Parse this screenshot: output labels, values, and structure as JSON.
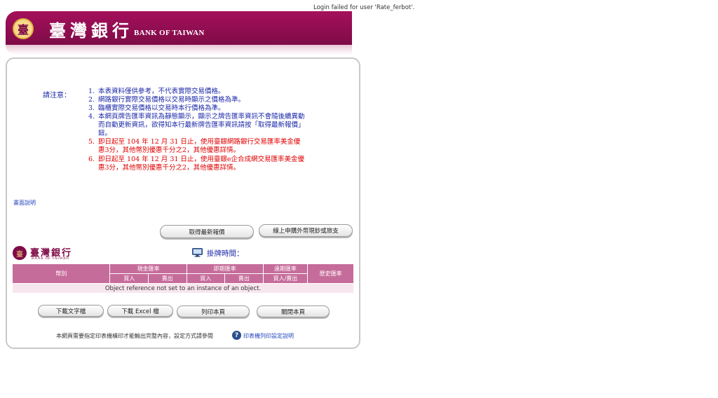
{
  "status": {
    "login_message": "Login failed for user 'Rate_ferbot'."
  },
  "header": {
    "brand_zh": "臺灣銀行",
    "brand_en": "BANK OF TAIWAN",
    "logo_glyph": "臺"
  },
  "notice": {
    "label": "請注意：",
    "items": [
      {
        "num": "1.",
        "text": "本表資料僅供參考，不代表實際交易價格。",
        "color": "blue"
      },
      {
        "num": "2.",
        "text": "網路銀行實際交易價格以交易時顯示之價格為準。",
        "color": "blue"
      },
      {
        "num": "3.",
        "text": "臨櫃實際交易價格以交易時本行價格為準。",
        "color": "blue"
      },
      {
        "num": "4.",
        "text": "本網頁牌告匯率資訊為靜態顯示，顯示之牌告匯率資訊不會隨後續異動而自動更新資訊，欲得知本行最新牌告匯率資訊請按「取得最新報價」鈕。",
        "color": "blue"
      },
      {
        "num": "5.",
        "text": "即日起至 104 年 12 月 31 日止，使用臺銀網路銀行交易匯率美金優惠3分，其他幣別優惠千分之2，其他優惠詳情。",
        "color": "red"
      },
      {
        "num": "6.",
        "text": "即日起至 104 年 12 月 31 日止，使用臺銀e企合成網交易匯率美金優惠3分，其他幣別優惠千分之2，其他優惠詳情。",
        "color": "red"
      }
    ]
  },
  "links": {
    "help": "畫面說明",
    "print_setup": "印表機列印設定說明"
  },
  "buttons": {
    "latest_quote": "取得最新報價",
    "online_apply": "線上申購外幣現鈔或旅支",
    "download_text": "下載文字檔",
    "download_excel": "下載 Excel 檔",
    "print_page": "列印本頁",
    "close_page": "關閉本頁"
  },
  "small_logo": {
    "zh": "臺灣銀行",
    "en": "BANK OF TAIWAN",
    "glyph": "臺"
  },
  "quote_time_label": "掛牌時間：",
  "table": {
    "currency": "幣別",
    "cash": "現金匯率",
    "spot": "即期匯率",
    "forward": "遠期匯率",
    "history": "歷史匯率",
    "buy": "買入",
    "sell": "賣出",
    "buy_sell": "買入/賣出",
    "message": "Object reference not set to an instance of an object."
  },
  "print_note": "本網頁需要指定印表機橫印才能輸出完整內容，設定方式請參閱",
  "colors": {
    "brand": "#7e0b47",
    "table_header": "#c66c9a",
    "table_row": "#f8e6ee",
    "notice_blue": "#1d2aa8",
    "notice_red": "#e00000"
  },
  "icons": {
    "monitor": "monitor-icon",
    "help": "help-icon"
  }
}
